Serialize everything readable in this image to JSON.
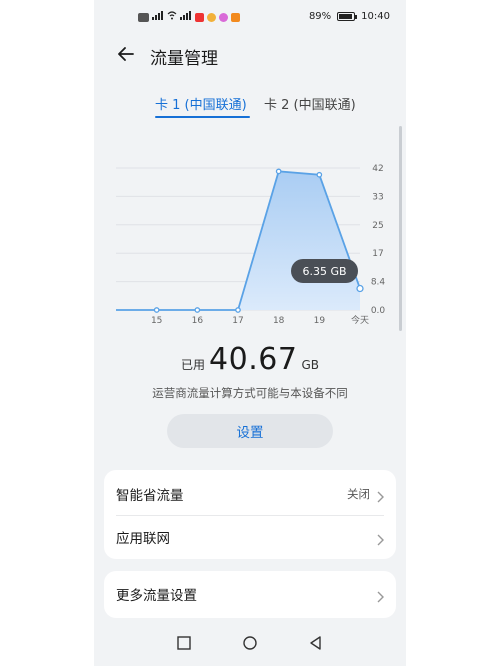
{
  "status_bar": {
    "battery": "89%",
    "battery_level": 0.89,
    "time": "10:40",
    "icons": [
      "hd-icon",
      "signal-icon",
      "wifi-icon",
      "signal-icon",
      "app-red-icon",
      "weibo-icon",
      "app-pink-icon",
      "app-orange-icon"
    ]
  },
  "header": {
    "title": "流量管理"
  },
  "tabs": [
    {
      "label": "卡 1 (中国联通)",
      "active": true
    },
    {
      "label": "卡 2 (中国联通)",
      "active": false
    }
  ],
  "chart_data": {
    "type": "area",
    "categories": [
      "15",
      "16",
      "17",
      "18",
      "19",
      "今天"
    ],
    "x": [
      "14",
      "15",
      "16",
      "17",
      "18",
      "19",
      "今天"
    ],
    "values": [
      0,
      0,
      0,
      0,
      41,
      40,
      6.35
    ],
    "y_ticks": [
      "42",
      "33",
      "25",
      "17",
      "8.4",
      "0.0"
    ],
    "ylim": [
      0,
      42
    ],
    "grid": true,
    "annotation": "6.35 GB",
    "color": "#5aa2e6"
  },
  "usage": {
    "prefix": "已用",
    "value": "40.67",
    "unit": "GB"
  },
  "note": "运营商流量计算方式可能与本设备不同",
  "settings_button": "设置",
  "list_card": [
    {
      "label": "智能省流量",
      "value": "关闭"
    },
    {
      "label": "应用联网",
      "value": ""
    }
  ],
  "more_card": {
    "label": "更多流量设置"
  },
  "nav": [
    "recent-icon",
    "home-icon",
    "back-icon"
  ]
}
